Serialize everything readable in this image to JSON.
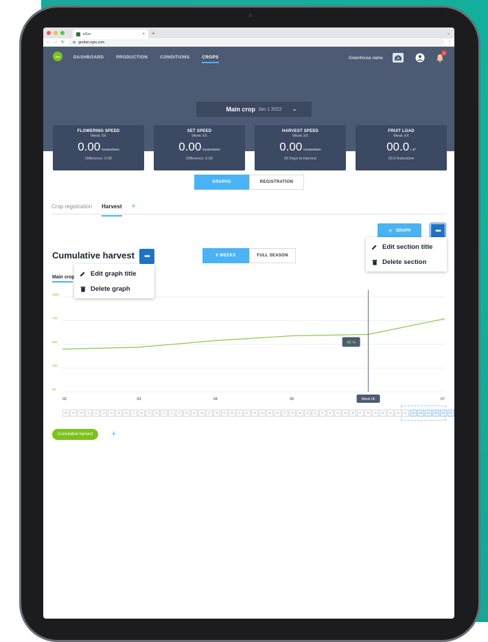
{
  "browser": {
    "tab_title": "eGro",
    "tab_close": "×",
    "new_tab": "+",
    "url": "grodan.egro.com"
  },
  "app": {
    "logo_text": "Gro",
    "nav": [
      "DASHBOARD",
      "PRODUCTION",
      "CONDITIONS",
      "CROPS"
    ],
    "greenhouse_name": "Greenhouse name",
    "notification_count": "8",
    "crop_select": {
      "label": "Main crop",
      "date": "Jan 1 2022"
    }
  },
  "kpis": [
    {
      "title": "FLOWERING SPEED",
      "week": "Week XX",
      "value": "0.00",
      "unit": "trusses/stem",
      "sub": "Difference: 0.00"
    },
    {
      "title": "SET SPEED",
      "week": "Week XX",
      "value": "0.00",
      "unit": "trusses/stem",
      "sub": "Difference: 0.00"
    },
    {
      "title": "HARVEST SPEED",
      "week": "Week XX",
      "value": "0.00",
      "unit": "trusses/stem",
      "sub": "00 Days to Harvest"
    },
    {
      "title": "FRUIT LOAD",
      "week": "Week XX",
      "value": "00.0",
      "unit": "/ m²",
      "sub": "00.0 fruits/stem"
    }
  ],
  "view_toggle": {
    "graphs": "GRAPHS",
    "registration": "REGISTRATION"
  },
  "subtabs": {
    "crop_registration": "Crop registration",
    "harvest": "Harvest",
    "add": "+"
  },
  "section": {
    "add_graph": "GRAPH",
    "add_graph_plus": "+",
    "more": "•••",
    "menu": {
      "edit": "Edit section title",
      "delete": "Delete section"
    }
  },
  "graph": {
    "title": "Cumulative harvest",
    "more": "•••",
    "range": {
      "six_weeks": "6 WEEKS",
      "full_season": "FULL SEASON"
    },
    "legend_tab": "Main crop",
    "menu": {
      "edit": "Edit graph title",
      "delete": "Delete graph"
    },
    "series_chip": "Cumulative harvest",
    "series_add": "+"
  },
  "chart_data": {
    "type": "line",
    "x": [
      "02",
      "03",
      "04",
      "05",
      "06",
      "07"
    ],
    "series": [
      {
        "values": [
          45000,
          47000,
          54000,
          59000,
          60500,
          77000
        ]
      }
    ],
    "y_ticks": [
      "0K",
      "25K",
      "50K",
      "75K",
      "100K"
    ],
    "ylim": [
      0,
      100000
    ],
    "grid": true,
    "cursor": {
      "x": "06",
      "label": "Week 06",
      "value_label": "48 %"
    },
    "color": "#8cc63f"
  },
  "week_strip": {
    "weeks": [
      "08",
      "09",
      "10",
      "11",
      "12",
      "13",
      "14",
      "15",
      "16",
      "17",
      "18",
      "19",
      "20",
      "21",
      "22",
      "23",
      "24",
      "25",
      "26",
      "27",
      "28",
      "29",
      "30",
      "31",
      "32",
      "33",
      "34",
      "35",
      "36",
      "37",
      "38",
      "39",
      "40",
      "41",
      "42",
      "43",
      "44",
      "45",
      "46",
      "47",
      "48",
      "49",
      "50",
      "51",
      "52",
      "53",
      "02",
      "03",
      "04",
      "05",
      "06",
      "07"
    ],
    "selected": [
      "02",
      "03",
      "04",
      "05",
      "06",
      "07"
    ]
  },
  "colors": {
    "header": "#4c5a73",
    "accent": "#4ab3f4",
    "primary_button": "#1f73c7",
    "series": "#8cc63f"
  }
}
